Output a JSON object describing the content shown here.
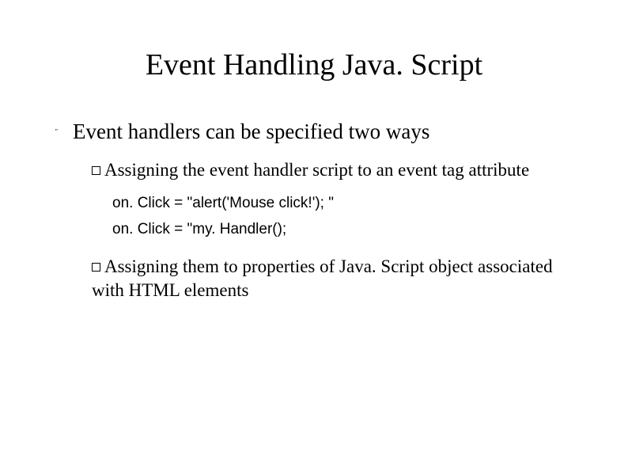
{
  "title": "Event Handling Java. Script",
  "bullet1": "Event handlers can be specified two ways",
  "sub1": "Assigning the event handler script to an event tag attribute",
  "code1": "on. Click = \"alert('Mouse click!'); \"",
  "code2": "on. Click = \"my. Handler();",
  "sub2": "Assigning them to properties of Java. Script object associated with HTML elements"
}
